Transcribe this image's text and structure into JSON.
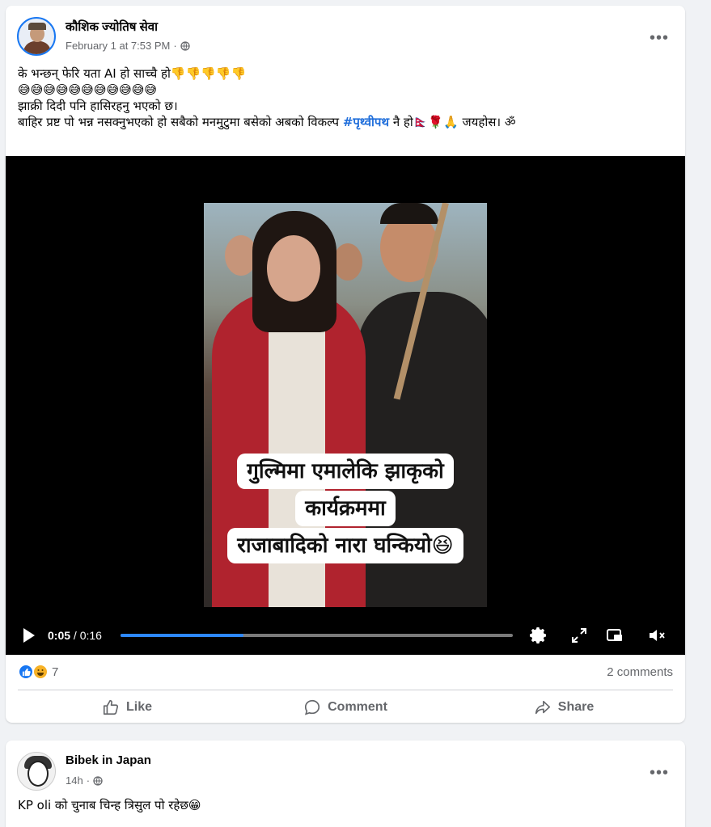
{
  "post1": {
    "author": "कौशिक ज्योतिष सेवा",
    "timestamp": "February 1 at 7:53 PM",
    "privacy_icon": "globe-icon",
    "more_label": "•••",
    "text_lines": [
      "के भन्छन् फेरि यता AI हो साच्चै हो👎👎👎👎👎",
      "😅😅😅😅😅😅😅😅😅😅😅",
      "झाक्री दिदी पनि हासिरहनु भएको छ।"
    ],
    "text_line4_before": "बाहिर प्रष्ट पो भन्न नसक्नुभएको हो सबैको मनमुटुमा बसेको अबको विकल्प ",
    "hashtag": "#पृथ्वीपथ",
    "text_line4_after": " नै हो🇳🇵🌹🙏 जयहोस। ॐ",
    "video": {
      "caption_lines": [
        "गुल्मिमा एमालेकि झाकृको",
        "कार्यक्रममा",
        "राजाबादिको नारा घन्कियो😆"
      ],
      "current_time": "0:05",
      "duration": "/ 0:16",
      "progress_fraction": 0.3125
    },
    "reactions_count": "7",
    "comments_label": "2 comments",
    "actions": {
      "like": "Like",
      "comment": "Comment",
      "share": "Share"
    }
  },
  "post2": {
    "author": "Bibek in Japan",
    "timestamp": "14h",
    "privacy_icon": "globe-icon",
    "more_label": "•••",
    "text_line1": "KP oli को चुनाब चिन्ह त्रिसुल पो रहेछ😁"
  },
  "colors": {
    "accent": "#1877f2",
    "hashtag": "#216fdb",
    "progress": "#2d88ff",
    "muted": "#65676b",
    "background": "#f0f2f5"
  }
}
